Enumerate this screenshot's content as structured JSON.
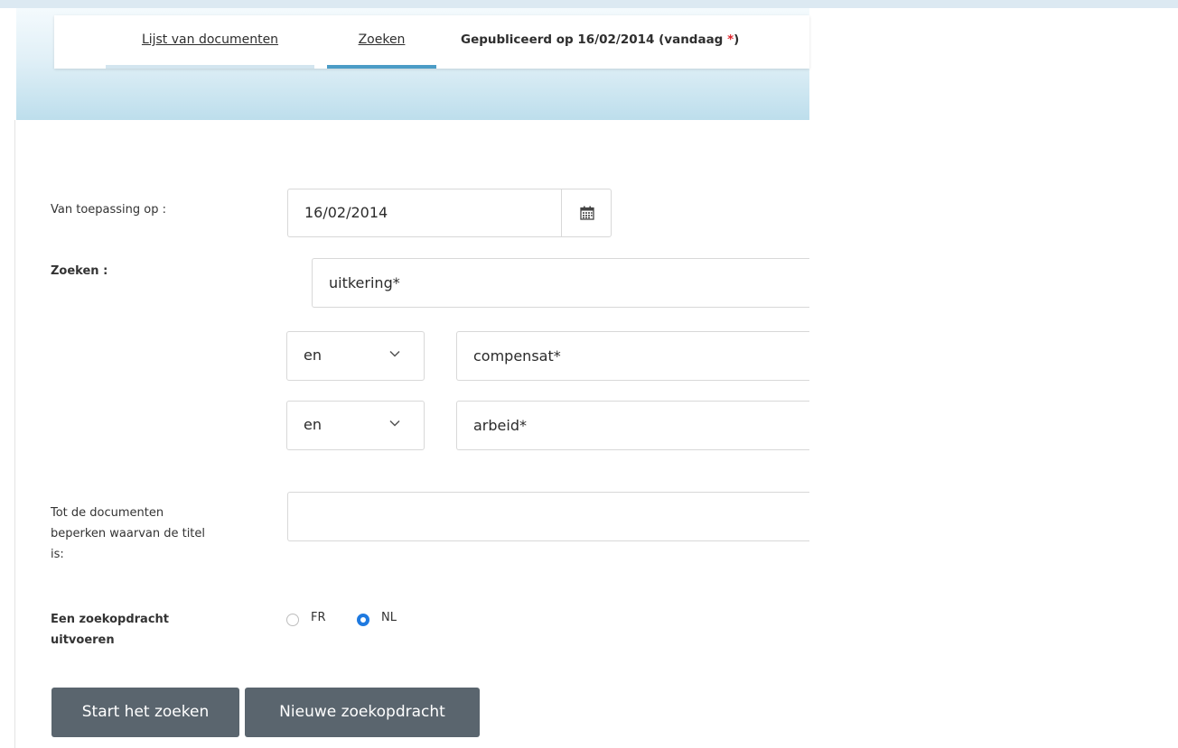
{
  "tabs": {
    "documents": "Lijst van documenten",
    "search": "Zoeken",
    "published": "Gepubliceerd op 16/02/2014 (vandaag ",
    "published_star": "*",
    "published_close": ")"
  },
  "form": {
    "applicable_label": "Van toepassing op :",
    "applicable_date": "16/02/2014",
    "search_label": "Zoeken :",
    "term1": "uitkering*",
    "operator2": "en",
    "term2": "compensat*",
    "operator3": "en",
    "term3": "arbeid*",
    "title_restrict_label_line1": "Tot de documenten",
    "title_restrict_label_line2": "beperken waarvan de titel",
    "title_restrict_label_line3": "is:",
    "title_restrict_value": "",
    "run_search_label_line1": "Een zoekopdracht",
    "run_search_label_line2": "uitvoeren",
    "lang_fr": "FR",
    "lang_nl": "NL",
    "selected_language": "NL"
  },
  "buttons": {
    "start": "Start het zoeken",
    "new": "Nieuwe zoekopdracht"
  },
  "colors": {
    "active_tab": "#4b9cc6",
    "button_bg": "#5a656e",
    "required_star": "#e0232b",
    "radio_selected": "#1f7ae0"
  },
  "icons": {
    "calendar": "calendar-icon",
    "chevron": "chevron-down-icon"
  }
}
